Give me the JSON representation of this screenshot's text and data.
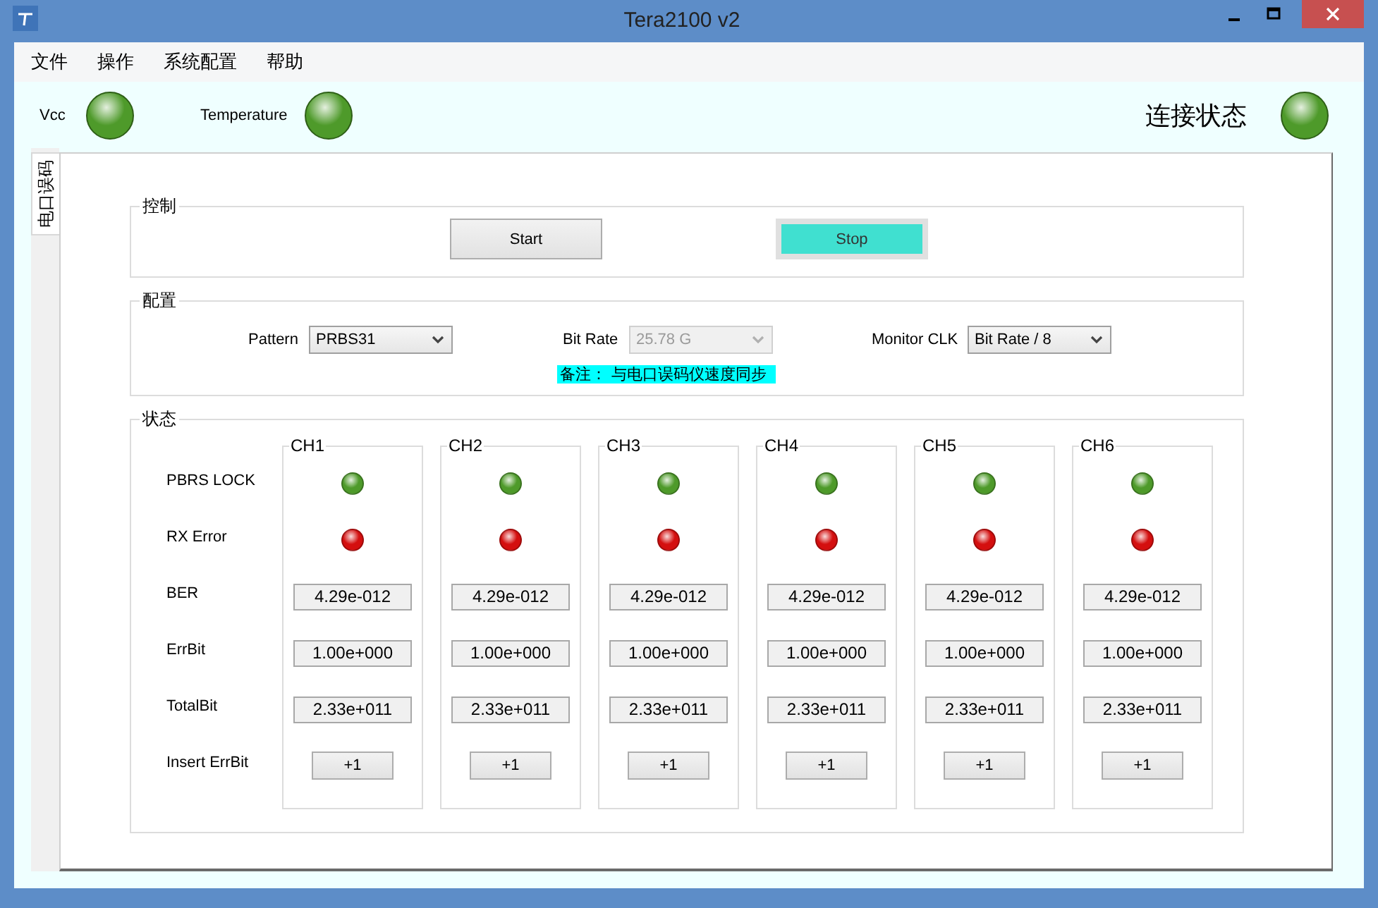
{
  "window": {
    "title": "Tera2100 v2"
  },
  "menu": [
    "文件",
    "操作",
    "系统配置",
    "帮助"
  ],
  "indicators": [
    {
      "label": "Vcc",
      "color": "#4e9a2a"
    },
    {
      "label": "Temperature",
      "color": "#4e9a2a"
    }
  ],
  "connection": {
    "label": "连接状态",
    "color": "#4e9a2a"
  },
  "tabs": [
    {
      "label": "电口误码",
      "selected": true
    }
  ],
  "control": {
    "title": "控制",
    "buttons": [
      {
        "label": "Start",
        "highlighted": false
      },
      {
        "label": "Stop",
        "highlighted": true
      }
    ]
  },
  "config": {
    "title": "配置",
    "fields": [
      {
        "label": "Pattern",
        "value": "PRBS31",
        "disabled": false
      },
      {
        "label": "Bit Rate",
        "value": "25.78 G",
        "disabled": true
      },
      {
        "label": "Monitor CLK",
        "value": "Bit Rate / 8",
        "disabled": false
      }
    ],
    "note": "备注： 与电口误码仪速度同步"
  },
  "status": {
    "title": "状态",
    "row_labels": [
      "PBRS LOCK",
      "RX Error",
      "BER",
      "ErrBit",
      "TotalBit",
      "Insert ErrBit"
    ],
    "channels": [
      {
        "name": "CH1",
        "leds": [
          {
            "color": "#4e9a2a"
          },
          {
            "color": "#d40f0f"
          }
        ],
        "ber": "4.29e-012",
        "err_bit": "1.00e+000",
        "total_bit": "2.33e+011",
        "insert": "+1"
      },
      {
        "name": "CH2",
        "leds": [
          {
            "color": "#4e9a2a"
          },
          {
            "color": "#d40f0f"
          }
        ],
        "ber": "4.29e-012",
        "err_bit": "1.00e+000",
        "total_bit": "2.33e+011",
        "insert": "+1"
      },
      {
        "name": "CH3",
        "leds": [
          {
            "color": "#4e9a2a"
          },
          {
            "color": "#d40f0f"
          }
        ],
        "ber": "4.29e-012",
        "err_bit": "1.00e+000",
        "total_bit": "2.33e+011",
        "insert": "+1"
      },
      {
        "name": "CH4",
        "leds": [
          {
            "color": "#4e9a2a"
          },
          {
            "color": "#d40f0f"
          }
        ],
        "ber": "4.29e-012",
        "err_bit": "1.00e+000",
        "total_bit": "2.33e+011",
        "insert": "+1"
      },
      {
        "name": "CH5",
        "leds": [
          {
            "color": "#4e9a2a"
          },
          {
            "color": "#d40f0f"
          }
        ],
        "ber": "4.29e-012",
        "err_bit": "1.00e+000",
        "total_bit": "2.33e+011",
        "insert": "+1"
      },
      {
        "name": "CH6",
        "leds": [
          {
            "color": "#4e9a2a"
          },
          {
            "color": "#d40f0f"
          }
        ],
        "ber": "4.29e-012",
        "err_bit": "1.00e+000",
        "total_bit": "2.33e+011",
        "insert": "+1"
      }
    ]
  }
}
